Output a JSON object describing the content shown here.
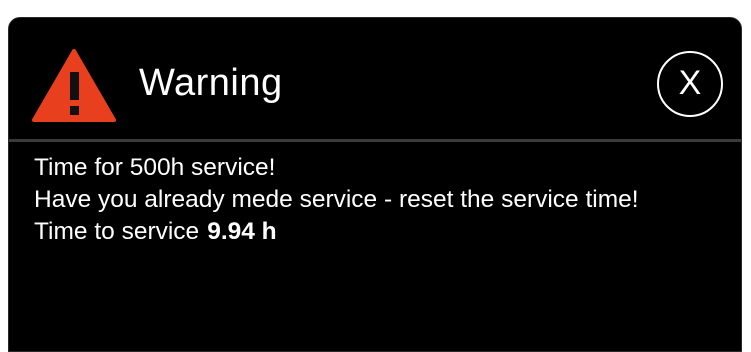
{
  "dialog": {
    "title": "Warning",
    "icon": "warning-triangle-icon",
    "icon_color": "#e8401f",
    "close_label": "X",
    "lines": [
      "Time for 500h service!",
      "Have you already mede service - reset the service time!"
    ],
    "time_to_service": {
      "label": "Time to service",
      "value": "9.94 h"
    }
  }
}
